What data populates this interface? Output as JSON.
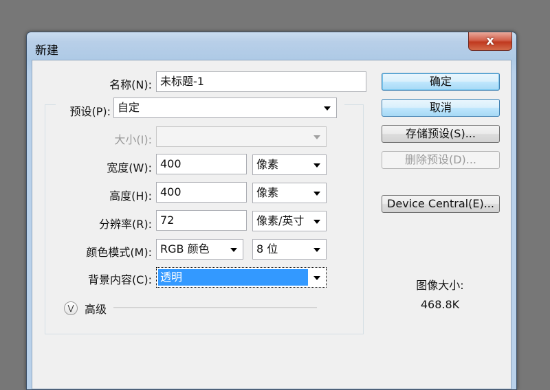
{
  "window": {
    "title": "新建",
    "close_glyph": "x"
  },
  "form": {
    "name_label": "名称(N):",
    "name_value": "未标题-1",
    "preset_label": "预设(P):",
    "preset_value": "自定",
    "size_label": "大小(I):",
    "size_value": "",
    "width_label": "宽度(W):",
    "width_value": "400",
    "width_unit": "像素",
    "height_label": "高度(H):",
    "height_value": "400",
    "height_unit": "像素",
    "resolution_label": "分辨率(R):",
    "resolution_value": "72",
    "resolution_unit": "像素/英寸",
    "color_mode_label": "颜色模式(M):",
    "color_mode_value": "RGB 颜色",
    "bit_depth_value": "8 位",
    "background_label": "背景内容(C):",
    "background_value": "透明",
    "advanced_label": "高级"
  },
  "buttons": {
    "ok": "确定",
    "cancel": "取消",
    "save_preset": "存储预设(S)...",
    "delete_preset": "删除预设(D)...",
    "device_central": "Device Central(E)..."
  },
  "info": {
    "image_size_label": "图像大小:",
    "image_size_value": "468.8K"
  },
  "colors": {
    "selection": "#3399ff",
    "desktop": "#777777"
  }
}
